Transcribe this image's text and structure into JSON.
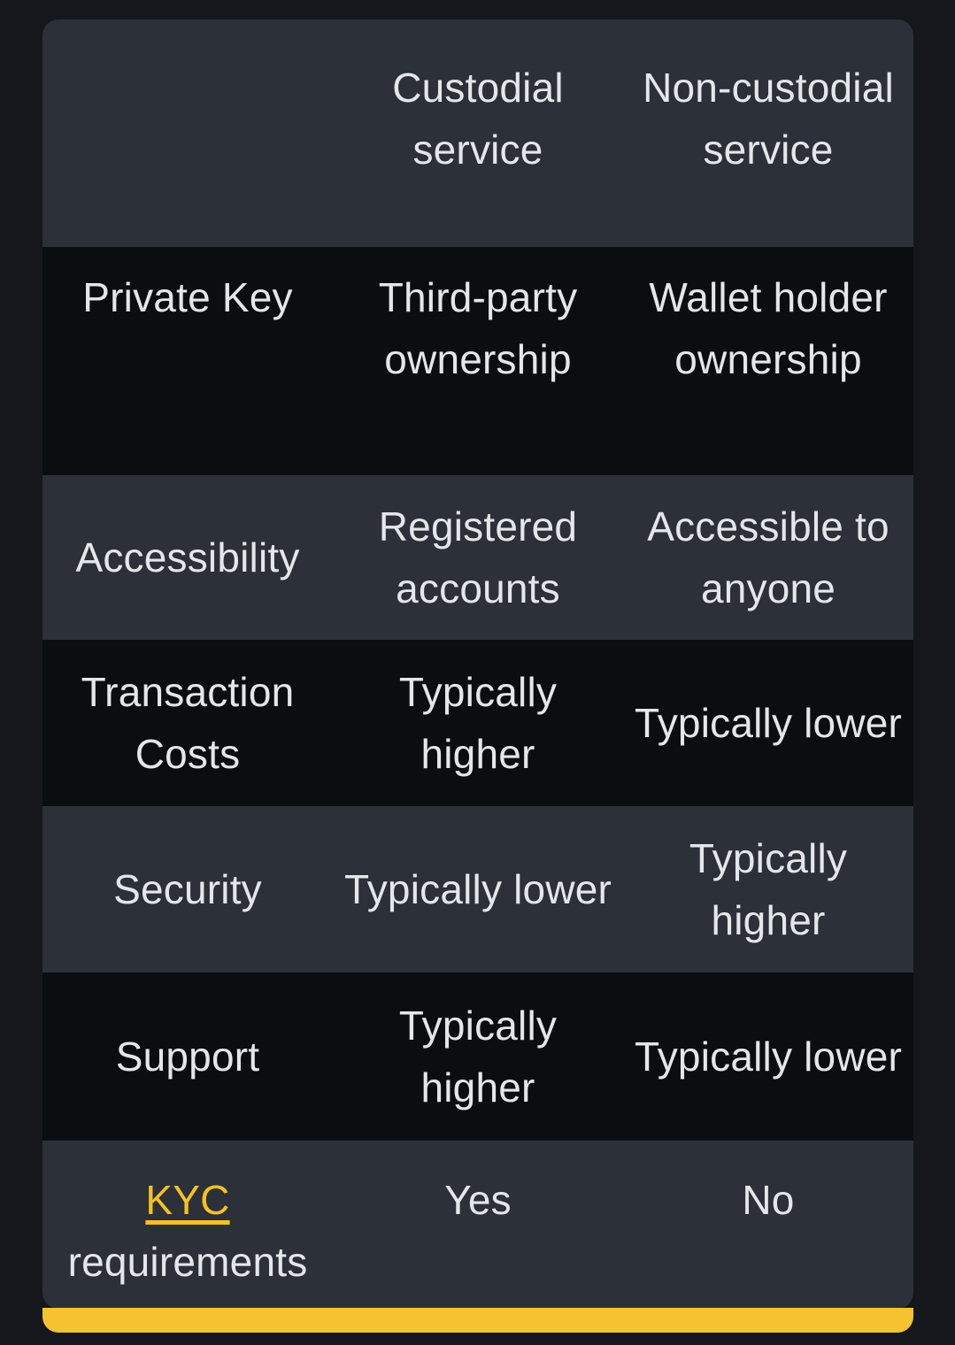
{
  "theme": {
    "page_background": "#16171c",
    "row_shade_dark": "#2c3039",
    "row_shade_black": "#0b0e11",
    "text_color": "#e4e6e9",
    "link_color": "#f5c022",
    "accent_bar_color": "#f5c231"
  },
  "table": {
    "headers": {
      "feature": "",
      "custodial": "Custodial service",
      "non_custodial": "Non-custodial service"
    },
    "rows": [
      {
        "feature": "Private Key",
        "custodial": "Third-party ownership",
        "non_custodial": "Wallet holder ownership"
      },
      {
        "feature": "Accessibility",
        "custodial": "Registered accounts",
        "non_custodial": "Accessible to anyone"
      },
      {
        "feature": "Transaction Costs",
        "custodial": "Typically higher",
        "non_custodial": "Typically lower"
      },
      {
        "feature": "Security",
        "custodial": "Typically lower",
        "non_custodial": "Typically higher"
      },
      {
        "feature": "Support",
        "custodial": "Typically higher",
        "non_custodial": "Typically lower"
      },
      {
        "feature_link": "KYC",
        "feature_rest": " requirements",
        "custodial": "Yes",
        "non_custodial": "No"
      }
    ]
  }
}
